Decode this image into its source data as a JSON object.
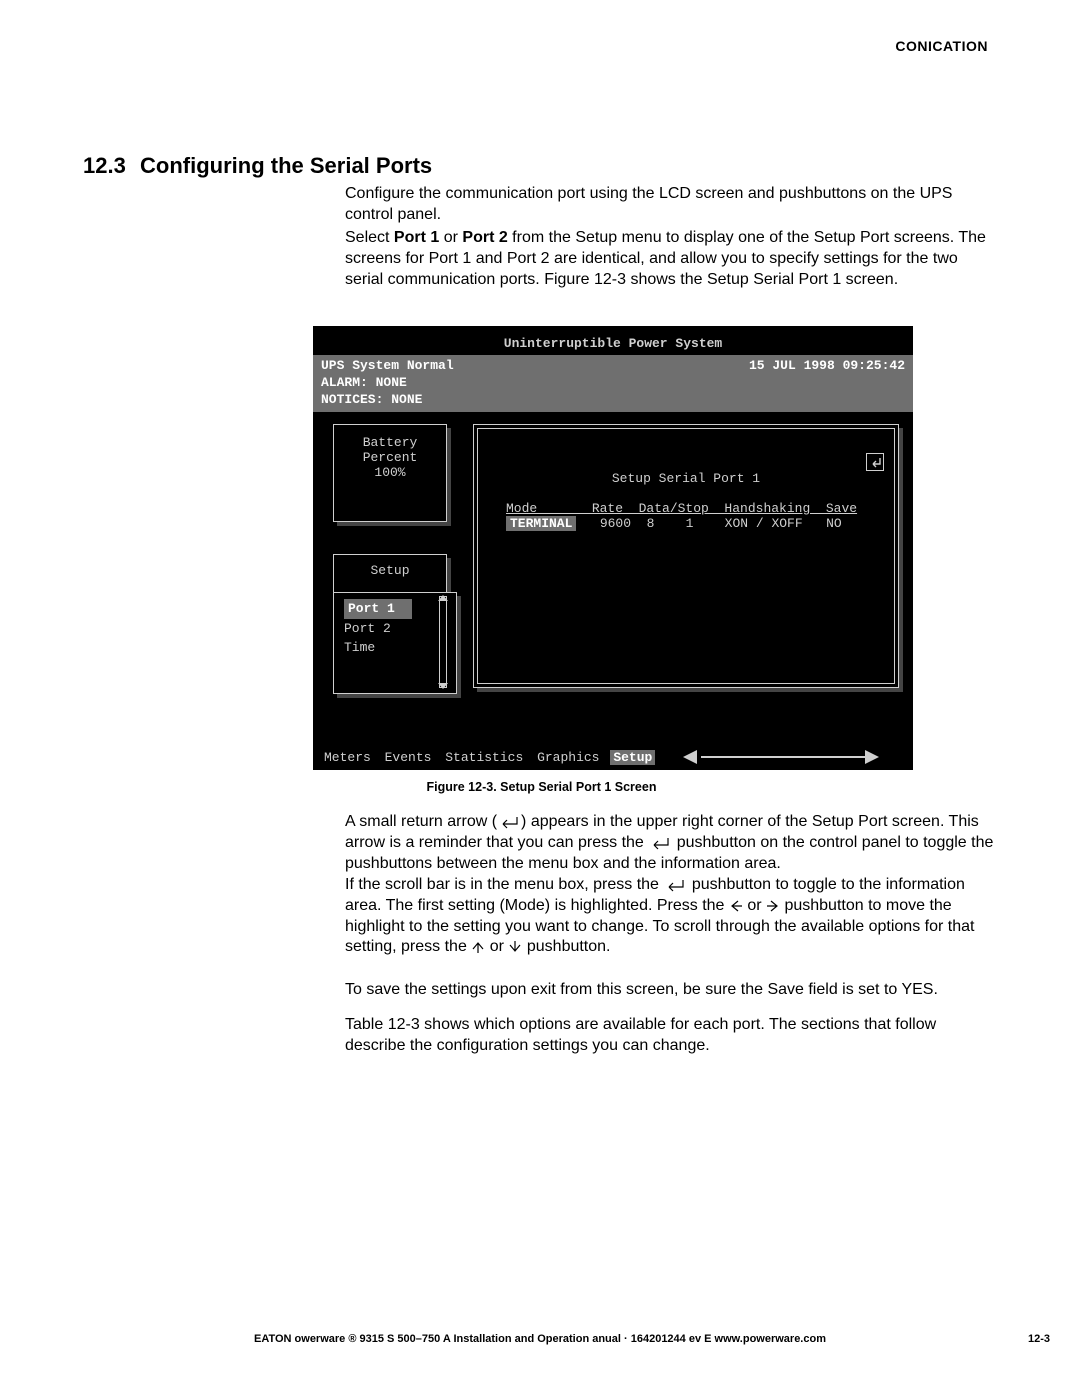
{
  "header_topic": "CONICATION",
  "section_number": "12.3",
  "section_title": "Configuring the Serial Ports",
  "para1": "Configure the communication port using the LCD screen and pushbuttons on the UPS control panel.",
  "para2_pre": "Select ",
  "para2_b1": "Port 1",
  "para2_mid1": " or ",
  "para2_b2": "Port 2",
  "para2_post": " from the Setup menu to display one of the Setup Port screens. The screens for Port 1 and Port 2 are identical, and allow you to specify settings for the two serial communication ports. Figure 12-3 shows the Setup Serial Port 1 screen.",
  "figure_caption": "Figure 12-3. Setup Serial Port 1 Screen",
  "para3a": "A small return arrow (",
  "para3b": ") appears in the upper right corner of the Setup Port screen. This arrow is a reminder that you can press the ",
  "para3c": " pushbutton on the control panel to toggle the pushbuttons between the menu box and the information area.",
  "para4a": "If the scroll bar is in the menu box, press the ",
  "para4b": " pushbutton to toggle to the information area. The first setting (Mode) is highlighted. Press the ",
  "para4c": " or ",
  "para4d": " pushbutton to move the highlight to the setting you want to change. To scroll through the available options for that setting, press the ",
  "para4e": " or ",
  "para4f": " pushbutton.",
  "para5": "To save the settings upon exit from this screen, be sure the Save field is set to YES.",
  "para6": "Table 12-3 shows which options are available for each port. The sections that follow describe the configuration settings you can change.",
  "lcd": {
    "title": "Uninterruptible Power System",
    "status_left": "UPS System Normal",
    "status_right": "15 JUL 1998  09:25:42",
    "alarm": "ALARM:  NONE",
    "notices": "NOTICES: NONE",
    "battery_l1": "Battery",
    "battery_l2": "Percent",
    "battery_l3": "100%",
    "setup_label": "Setup",
    "menu_sel": "Port 1",
    "menu2": "Port 2",
    "menu3": "Time",
    "panel_title": "Setup Serial Port 1",
    "col_headers": "Mode       Rate  Data/Stop  Handshaking  Save",
    "col_val_mode": "TERMINAL",
    "col_val_rest": "   9600  8    1    XON / XOFF   NO",
    "tabs": [
      "Meters",
      "Events",
      "Statistics",
      "Graphics"
    ],
    "tab_selected": "Setup"
  },
  "footer_center": "EATON  owerware ® 9315 S 500–750 A Installation and Operation  anual  ·  164201244  ev E www.powerware.com",
  "footer_right": "12-3"
}
